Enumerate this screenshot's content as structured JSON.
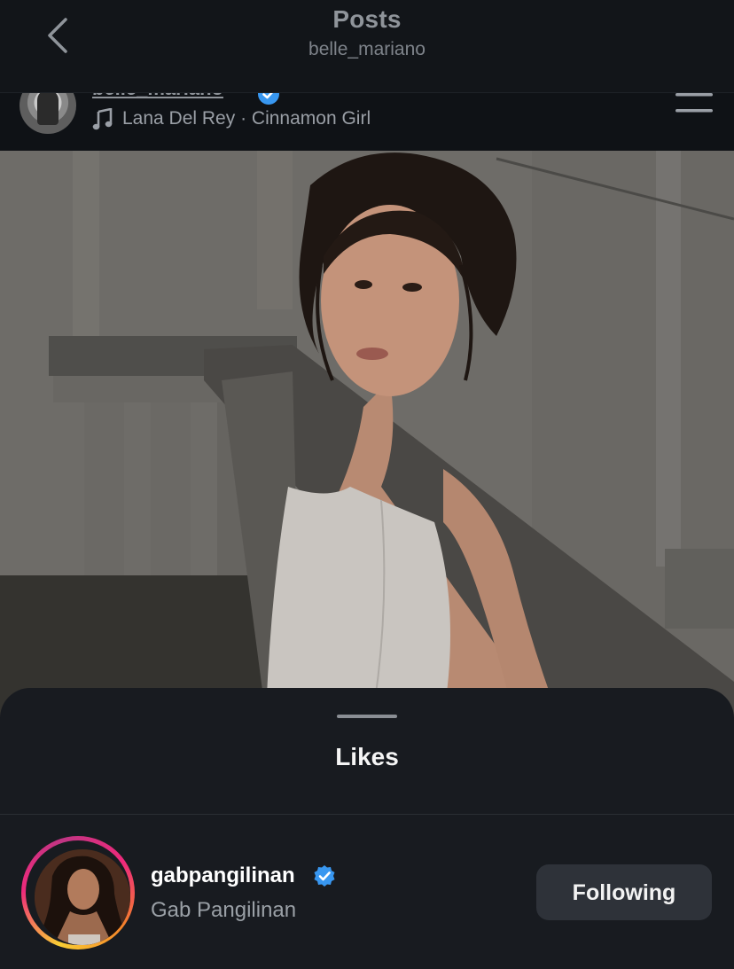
{
  "nav": {
    "title": "Posts",
    "subtitle": "belle_mariano",
    "back_icon": "chevron-left-icon"
  },
  "post": {
    "username": "belle_mariano",
    "verified_icon": "verified-badge-icon",
    "music_icon": "music-note-icon",
    "song": "Lana Del Rey · Cinnamon Girl",
    "menu_icon": "menu-icon"
  },
  "likes_sheet": {
    "title": "Likes",
    "users": [
      {
        "username": "gabpangilinan",
        "full_name": "Gab Pangilinan",
        "verified": true,
        "has_story": true,
        "button_label": "Following"
      }
    ]
  },
  "colors": {
    "background": "#0f1216",
    "sheet": "#181b20",
    "verified": "#3897f0",
    "button": "#2e3239"
  }
}
